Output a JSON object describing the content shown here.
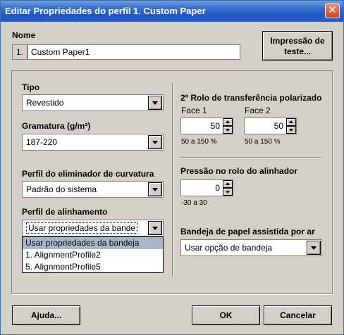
{
  "window": {
    "title": "Editar Propriedades do perfil 1. Custom Paper",
    "close_glyph": "✕"
  },
  "name_section": {
    "label": "Nome",
    "index": "1.",
    "value": "Custom Paper1"
  },
  "test_button": {
    "line1": "Impressão de",
    "line2": "teste..."
  },
  "type": {
    "label": "Tipo",
    "value": "Revestido"
  },
  "weight": {
    "label": "Gramatura (g/m²)",
    "value": "187-220"
  },
  "decurler": {
    "label": "Perfil do eliminador de curvatura",
    "value": "Padrão do sistema"
  },
  "alignment": {
    "label": "Perfil de alinhamento",
    "value": "Usar propriedades da bande",
    "options": [
      "Usar propriedades da bandeja",
      "1. AlignmentProfile2",
      "5. AlignmentProfile5"
    ]
  },
  "transfer_roll": {
    "label": "2º Rolo de transferência polarizado",
    "face1_label": "Face 1",
    "face1_value": "50",
    "face1_range": "50 a 150 %",
    "face2_label": "Face 2",
    "face2_value": "50",
    "face2_range": "50 a 150 %"
  },
  "registration_roll": {
    "label": "Pressão no rolo do alinhador",
    "value": "0",
    "range": "-30 a 30"
  },
  "assisted_tray": {
    "label": "Bandeja de papel assistida por ar",
    "value": "Usar opção de bandeja"
  },
  "footer": {
    "help": "Ajuda...",
    "ok": "OK",
    "cancel": "Cancelar"
  }
}
